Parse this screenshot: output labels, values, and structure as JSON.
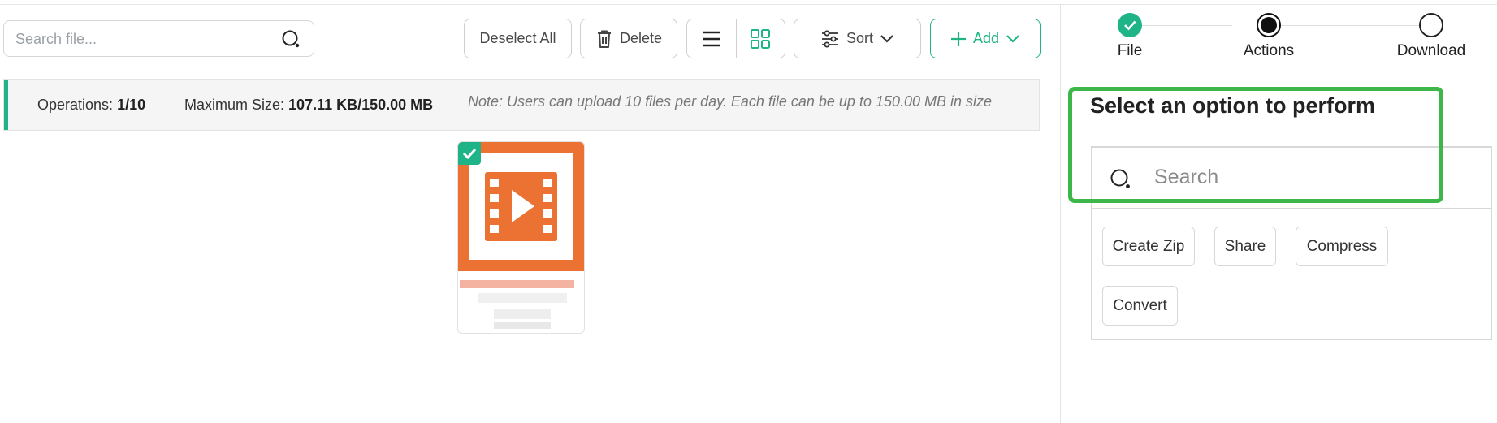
{
  "toolbar": {
    "search_placeholder": "Search file...",
    "deselect_label": "Deselect All",
    "delete_label": "Delete",
    "sort_label": "Sort",
    "add_label": "Add"
  },
  "info": {
    "operations_label": "Operations:",
    "operations_value": "1/10",
    "max_size_label": "Maximum Size:",
    "max_size_value": "107.11 KB/150.00 MB",
    "note": "Note: Users can upload 10 files per day. Each file can be up to 150.00 MB in size"
  },
  "file": {
    "type_icon": "video-file-icon",
    "selected": true
  },
  "steps": [
    {
      "label": "File",
      "state": "done"
    },
    {
      "label": "Actions",
      "state": "current"
    },
    {
      "label": "Download",
      "state": "pending"
    }
  ],
  "panel": {
    "title": "Select an option to perform",
    "search_placeholder": "Search",
    "actions": [
      "Create Zip",
      "Share",
      "Compress",
      "Convert"
    ]
  },
  "colors": {
    "accent": "#1fb487",
    "video_orange": "#ec7234",
    "highlight": "#3db74a"
  }
}
